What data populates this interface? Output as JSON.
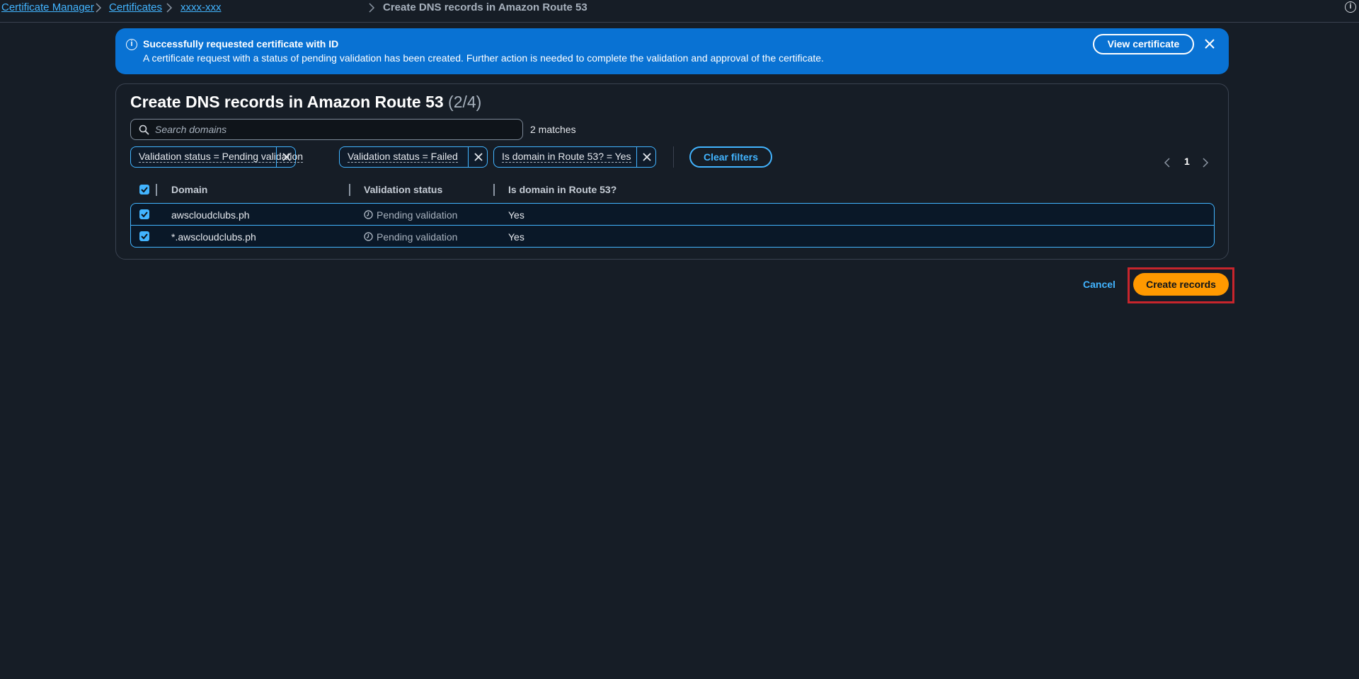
{
  "breadcrumb": {
    "items": [
      "Certificate Manager",
      "Certificates",
      "xxxx-xxx"
    ],
    "current": "Create DNS records in Amazon Route 53"
  },
  "flash": {
    "title": "Successfully requested certificate with ID",
    "message": "A certificate request with a status of pending validation has been created. Further action is needed to complete the validation and approval of the certificate.",
    "action_label": "View certificate",
    "color": "#0972d3"
  },
  "panel": {
    "title": "Create DNS records in Amazon Route 53",
    "count": "(2/4)",
    "search_placeholder": "Search domains",
    "matches": "2 matches",
    "filters": [
      "Validation status = Pending validation",
      "Validation status = Failed",
      "Is domain in Route 53? = Yes"
    ],
    "clear_filters_label": "Clear filters",
    "page": "1",
    "columns": [
      "Domain",
      "Validation status",
      "Is domain in Route 53?"
    ],
    "rows": [
      {
        "domain": "awscloudclubs.ph",
        "status": "Pending validation",
        "in_route53": "Yes",
        "selected": true
      },
      {
        "domain": "*.awscloudclubs.ph",
        "status": "Pending validation",
        "in_route53": "Yes",
        "selected": true
      }
    ]
  },
  "actions": {
    "cancel_label": "Cancel",
    "create_label": "Create records",
    "primary_color": "#ff9900",
    "highlight_color": "#c7252c"
  },
  "icons": [
    "chevron-right-icon",
    "info-icon",
    "close-icon",
    "search-icon",
    "checkmark-icon",
    "clock-icon",
    "chevron-left-icon"
  ]
}
